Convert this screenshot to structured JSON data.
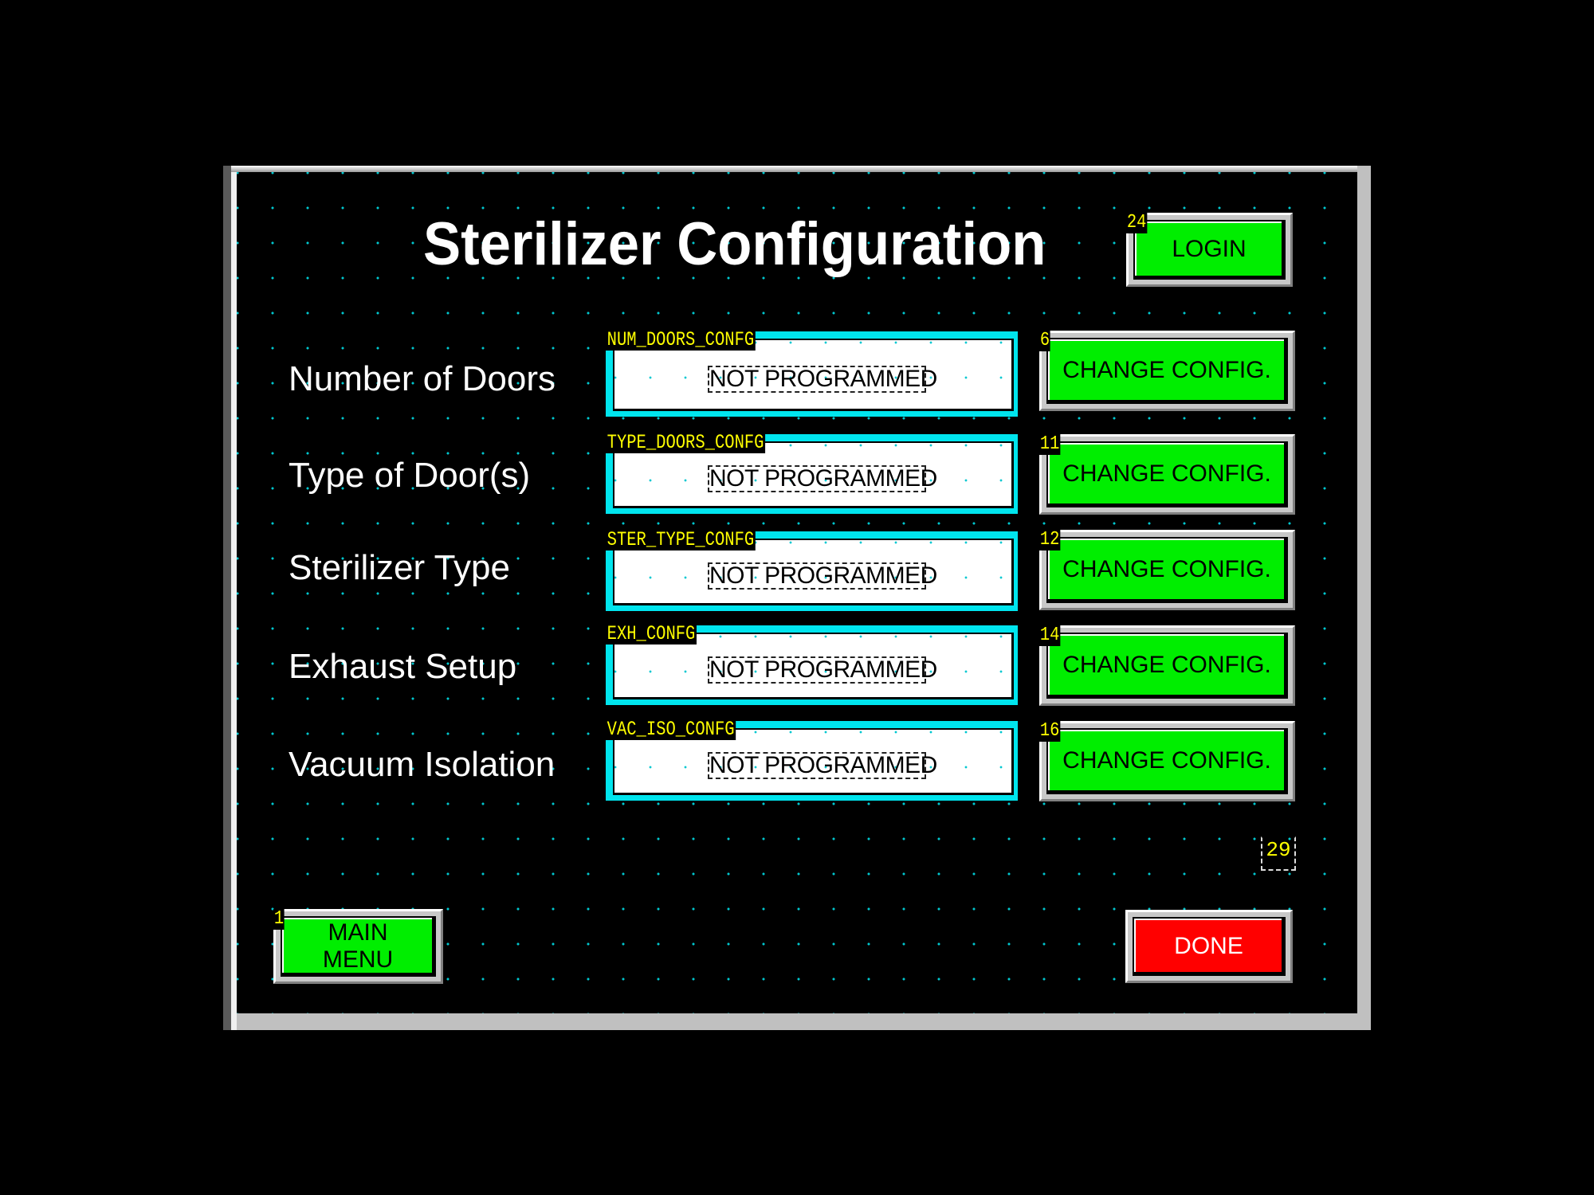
{
  "screen": {
    "title": "Sterilizer Configuration",
    "login_button": {
      "label": "LOGIN",
      "index": "24"
    },
    "rows": [
      {
        "label": "Number of Doors",
        "tag": "NUM_DOORS_CONFG",
        "value": "NOT PROGRAMMED",
        "button_label": "CHANGE CONFIG.",
        "button_index": "6"
      },
      {
        "label": "Type of Door(s)",
        "tag": "TYPE_DOORS_CONFG",
        "value": "NOT PROGRAMMED",
        "button_label": "CHANGE CONFIG.",
        "button_index": "11"
      },
      {
        "label": "Sterilizer Type",
        "tag": "STER_TYPE_CONFG",
        "value": "NOT PROGRAMMED",
        "button_label": "CHANGE CONFIG.",
        "button_index": "12"
      },
      {
        "label": "Exhaust Setup",
        "tag": "EXH_CONFG",
        "value": "NOT PROGRAMMED",
        "button_label": "CHANGE CONFIG.",
        "button_index": "14"
      },
      {
        "label": "Vacuum Isolation",
        "tag": "VAC_ISO_CONFG",
        "value": "NOT PROGRAMMED",
        "button_label": "CHANGE CONFIG.",
        "button_index": "16"
      }
    ],
    "marker_index": "29",
    "main_menu_button": {
      "label_line1": "MAIN",
      "label_line2": "MENU",
      "index": "1"
    },
    "done_button": {
      "label": "DONE"
    }
  },
  "colors": {
    "background": "#000000",
    "grid_dot": "#00c8d0",
    "button_green": "#00ee00",
    "button_red": "#ff0000",
    "field_border": "#00e5ee",
    "tag_text": "#ffff00"
  }
}
